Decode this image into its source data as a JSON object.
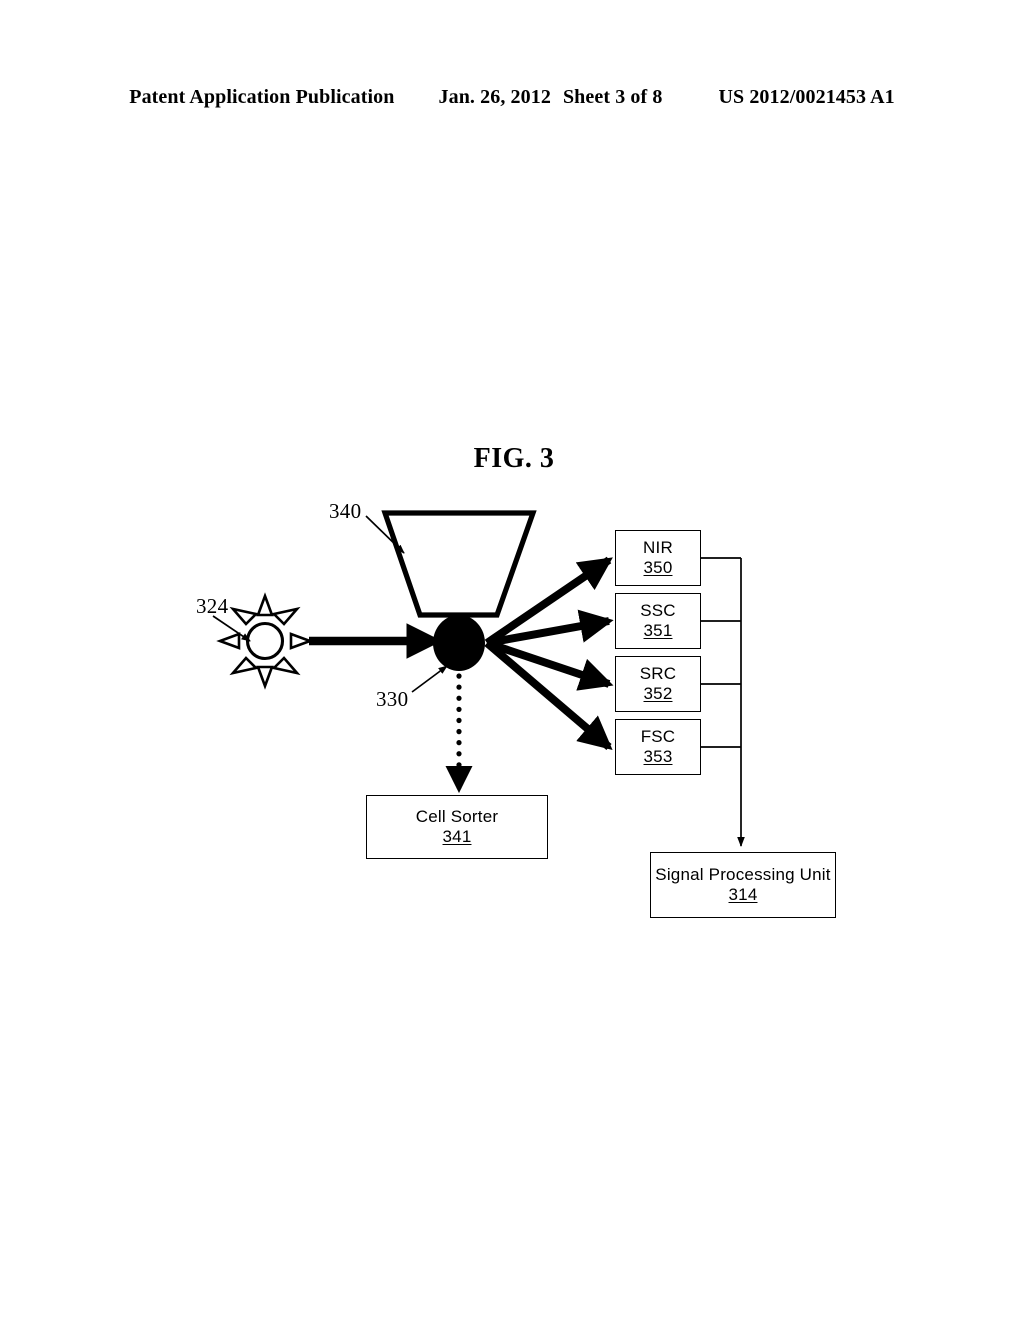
{
  "header": {
    "publication": "Patent Application Publication",
    "date": "Jan. 26, 2012",
    "sheet": "Sheet 3 of 8",
    "doc_number": "US 2012/0021453 A1"
  },
  "figure": {
    "title": "FIG. 3",
    "ink_color": "#000000",
    "background_color": "#ffffff"
  },
  "reference_labels": {
    "light_source": "324",
    "cell": "330",
    "nozzle": "340"
  },
  "detectors": [
    {
      "label": "NIR",
      "number": "350"
    },
    {
      "label": "SSC",
      "number": "351"
    },
    {
      "label": "SRC",
      "number": "352"
    },
    {
      "label": "FSC",
      "number": "353"
    }
  ],
  "blocks": {
    "cell_sorter": {
      "label": "Cell Sorter",
      "number": "341"
    },
    "signal_processing_unit": {
      "label": "Signal Processing Unit",
      "number": "314"
    }
  },
  "icons": {
    "light_source": "sun-icon",
    "cell": "filled-circle-icon",
    "nozzle": "trapezoid-nozzle-icon"
  }
}
